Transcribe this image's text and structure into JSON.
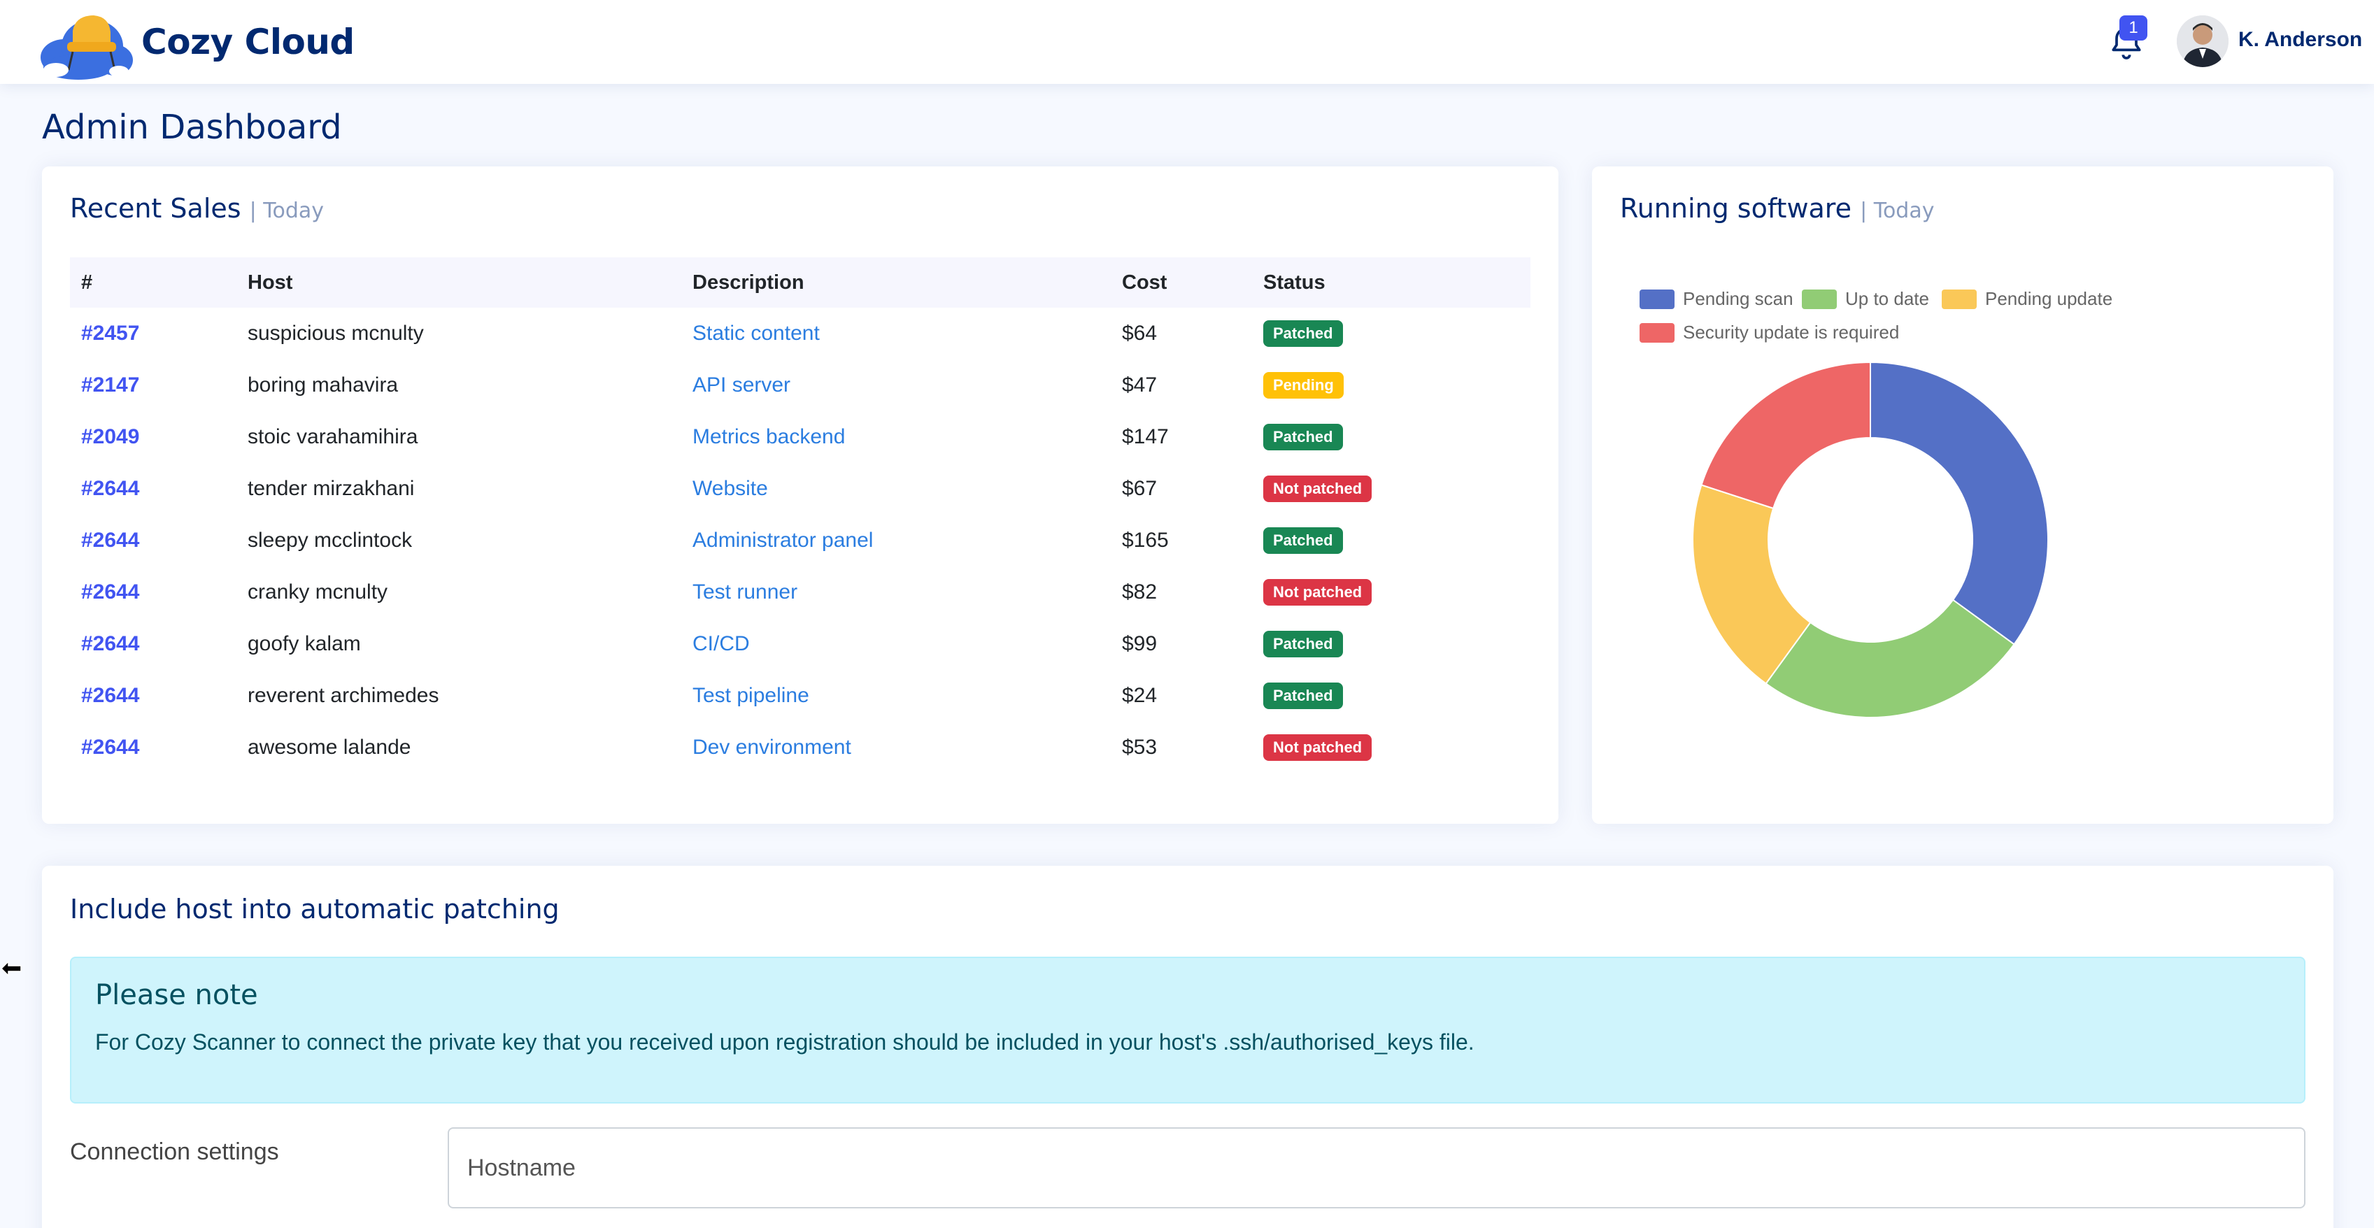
{
  "header": {
    "brand": "Cozy Cloud",
    "notifications_count": "1",
    "username": "K. Anderson"
  },
  "page": {
    "title": "Admin Dashboard"
  },
  "recent_sales": {
    "title": "Recent Sales",
    "subtitle": "| Today",
    "columns": [
      "#",
      "Host",
      "Description",
      "Cost",
      "Status"
    ],
    "rows": [
      {
        "id": "#2457",
        "host": "suspicious mcnulty",
        "description": "Static content",
        "cost": "$64",
        "status": "Patched",
        "status_type": "patched"
      },
      {
        "id": "#2147",
        "host": "boring mahavira",
        "description": "API server",
        "cost": "$47",
        "status": "Pending",
        "status_type": "pending"
      },
      {
        "id": "#2049",
        "host": "stoic varahamihira",
        "description": "Metrics backend",
        "cost": "$147",
        "status": "Patched",
        "status_type": "patched"
      },
      {
        "id": "#2644",
        "host": "tender mirzakhani",
        "description": "Website",
        "cost": "$67",
        "status": "Not patched",
        "status_type": "not"
      },
      {
        "id": "#2644",
        "host": "sleepy mcclintock",
        "description": "Administrator panel",
        "cost": "$165",
        "status": "Patched",
        "status_type": "patched"
      },
      {
        "id": "#2644",
        "host": "cranky mcnulty",
        "description": "Test runner",
        "cost": "$82",
        "status": "Not patched",
        "status_type": "not"
      },
      {
        "id": "#2644",
        "host": "goofy kalam",
        "description": "CI/CD",
        "cost": "$99",
        "status": "Patched",
        "status_type": "patched"
      },
      {
        "id": "#2644",
        "host": "reverent archimedes",
        "description": "Test pipeline",
        "cost": "$24",
        "status": "Patched",
        "status_type": "patched"
      },
      {
        "id": "#2644",
        "host": "awesome lalande",
        "description": "Dev environment",
        "cost": "$53",
        "status": "Not patched",
        "status_type": "not"
      }
    ]
  },
  "running_software": {
    "title": "Running software",
    "subtitle": "| Today"
  },
  "chart_data": {
    "type": "pie",
    "categories": [
      "Pending scan",
      "Up to date",
      "Pending update",
      "Security update is required"
    ],
    "values": [
      35,
      25,
      20,
      20
    ],
    "colors": [
      "#5470c6",
      "#91cc75",
      "#fac858",
      "#ee6666"
    ],
    "legend_position": "top-left",
    "donut": true
  },
  "patching": {
    "title": "Include host into automatic patching",
    "alert_title": "Please note",
    "alert_text": "For Cozy Scanner to connect the private key that you received upon registration should be included in your host's .ssh/authorised_keys file.",
    "connection_label": "Connection settings",
    "hostname_placeholder": "Hostname"
  },
  "colors": {
    "brand": "#012970",
    "accent": "#4154f1",
    "success": "#198754",
    "warning": "#ffc107",
    "danger": "#dc3545"
  }
}
